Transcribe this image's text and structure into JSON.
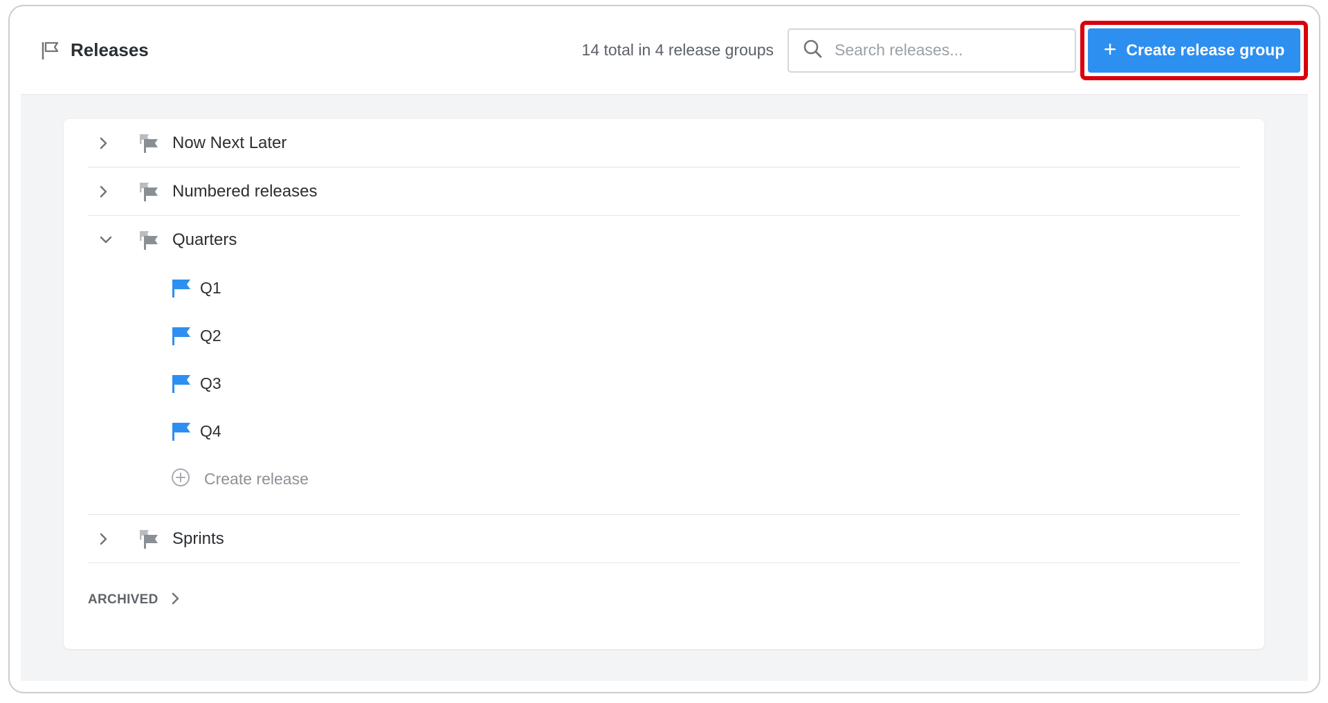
{
  "header": {
    "title": "Releases",
    "title_icon": "flag-outline-icon",
    "count_text": "14 total in 4 release groups",
    "search": {
      "placeholder": "Search releases...",
      "value": ""
    },
    "create_group_button": {
      "label": "Create release group",
      "icon": "plus-icon"
    }
  },
  "groups": [
    {
      "label": "Now Next Later",
      "expanded": false,
      "icon": "release-group-icon"
    },
    {
      "label": "Numbered releases",
      "expanded": false,
      "icon": "release-group-icon"
    },
    {
      "label": "Quarters",
      "expanded": true,
      "icon": "release-group-icon",
      "releases": [
        {
          "label": "Q1",
          "icon": "flag-icon"
        },
        {
          "label": "Q2",
          "icon": "flag-icon"
        },
        {
          "label": "Q3",
          "icon": "flag-icon"
        },
        {
          "label": "Q4",
          "icon": "flag-icon"
        }
      ],
      "create_release_label": "Create release"
    },
    {
      "label": "Sprints",
      "expanded": false,
      "icon": "release-group-icon"
    }
  ],
  "archived_label": "ARCHIVED",
  "colors": {
    "accent": "#2d8ff0",
    "highlight": "#d9000b",
    "icon_gray": "#8a8f96",
    "flag_blue": "#2d8ff0"
  }
}
